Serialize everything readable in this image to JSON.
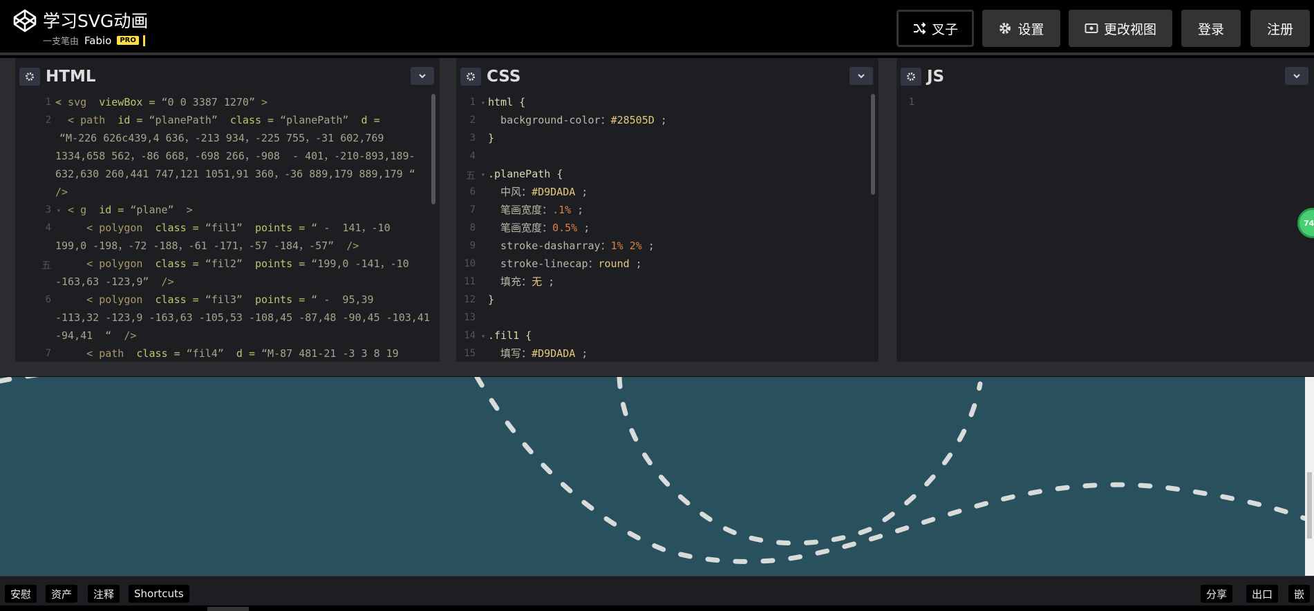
{
  "header": {
    "title": "学习SVG动画",
    "byline_prefix": "一支笔由",
    "author": "Fabio",
    "pro_badge": "PRO",
    "buttons": {
      "fork": "叉子",
      "settings": "设置",
      "change_view": "更改视图",
      "login": "登录",
      "signup": "注册"
    }
  },
  "panels": {
    "html": {
      "title": "HTML"
    },
    "css": {
      "title": "CSS"
    },
    "js": {
      "title": "JS"
    }
  },
  "html_code": {
    "line_numbers": [
      "1",
      "2",
      "3",
      "4",
      "五",
      "6",
      "7"
    ],
    "lines": [
      [
        "< svg  ",
        "viewBox = ",
        "“0 0 3387 1270” ",
        ">"
      ],
      [
        "  < path  ",
        "id = ",
        "“planePath”  ",
        "class = ",
        "“planePath”  ",
        "d ="
      ],
      [
        "“M-226 626c439,4 636，-213 934，-225 755，-31 602,769"
      ],
      [
        "1334,658 562，-86 668，-698 266，-908  - 401，-210-893,189-"
      ],
      [
        "632,630 260,441 747,121 1051,91 360，-36 889,179 889,179 “"
      ],
      [
        "/>"
      ],
      [
        "  < g  ",
        "id = ",
        "“plane” ",
        " >"
      ],
      [
        "     < polygon  ",
        "class = ",
        "“fil1”  ",
        "points = ",
        "“ -  141，-10"
      ],
      [
        "199,0 -198，-72 -188，-61 -171，-57 -184，-57”  ",
        "/>"
      ],
      [
        "     < polygon  ",
        "class = ",
        "“fil2”  ",
        "points = ",
        "“199,0 -141，-10"
      ],
      [
        "-163,63 -123,9” ",
        " />"
      ],
      [
        "     < polygon  ",
        "class = ",
        "“fil3”  ",
        "points = ",
        "“ -  95,39"
      ],
      [
        "-113,32 -123,9 -163,63 -105,53 -108,45 -87,48 -90,45 -103,41"
      ],
      [
        "-94,41  “ ",
        " />"
      ],
      [
        "     < path  ",
        "class = ",
        "“fil4”  ",
        "d = ",
        "“M-87 481-21 -3 3 8 19"
      ]
    ]
  },
  "css_code": {
    "line_numbers": [
      "1",
      "2",
      "3",
      "4",
      "五",
      "6",
      "7",
      "8",
      "9",
      "10",
      "11",
      "12",
      "13",
      "14",
      "15"
    ],
    "lines": [
      {
        "sel": "html {"
      },
      {
        "prop": "  background-color：",
        "val": "#28505D",
        "end": " ;"
      },
      {
        "sel": "}"
      },
      {
        "sel": ""
      },
      {
        "sel": ".planePath {"
      },
      {
        "prop": "  中风：",
        "val": "#D9DADA",
        "end": " ;"
      },
      {
        "prop": "  笔画宽度：",
        "num": ".1%",
        "end": " ;"
      },
      {
        "prop": "  笔画宽度：",
        "num": "0.5%",
        "end": " ;"
      },
      {
        "prop": "  stroke-dasharray：",
        "num": "1% 2%",
        "end": " ;"
      },
      {
        "prop": "  stroke-linecap：",
        "val": "round",
        "end": " ;"
      },
      {
        "prop": "  填充：",
        "val": "无",
        "end": " ;"
      },
      {
        "sel": "}"
      },
      {
        "sel": ""
      },
      {
        "sel": ".fil1 {"
      },
      {
        "prop": "  填写：",
        "val": "#D9DADA",
        "end": " ;"
      }
    ]
  },
  "js_code": {
    "line_numbers": [
      "1"
    ]
  },
  "badge": "74",
  "footer": {
    "left": [
      "安慰",
      "资产",
      "注释",
      "Shortcuts"
    ],
    "right": [
      "分享",
      "出口",
      "嵌"
    ]
  },
  "colors": {
    "preview_bg": "#28505D",
    "stroke": "#D9DADA"
  }
}
